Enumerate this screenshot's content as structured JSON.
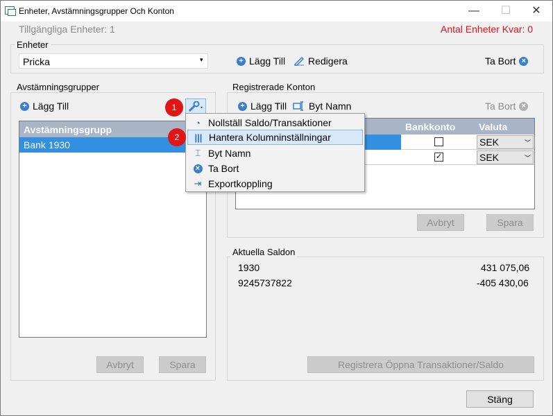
{
  "window": {
    "title": "Enheter, Avstämningsgrupper Och Konton",
    "minimize": "—",
    "maximize": "☐",
    "close": "✕"
  },
  "top": {
    "available_units": "Tillgängliga Enheter: 1",
    "remaining_units": "Antal Enheter Kvar: 0"
  },
  "units": {
    "legend": "Enheter",
    "selected": "Pricka",
    "add": "Lägg Till",
    "edit": "Redigera",
    "remove": "Ta Bort"
  },
  "groups": {
    "legend": "Avstämningsgrupper",
    "add": "Lägg Till",
    "header": "Avstämningsgrupp",
    "items": [
      "Bank 1930"
    ],
    "cancel": "Avbryt",
    "save": "Spara"
  },
  "menu": {
    "items": [
      "Nollställ Saldo/Transaktioner",
      "Hantera Kolumninställningar",
      "Byt Namn",
      "Ta Bort",
      "Exportkoppling"
    ]
  },
  "badges": {
    "one": "1",
    "two": "2"
  },
  "accounts": {
    "legend": "Registrerade Konton",
    "add": "Lägg Till",
    "rename": "Byt Namn",
    "remove": "Ta Bort",
    "col_bank": "Bankkonto",
    "col_currency": "Valuta",
    "rows": [
      {
        "checked": false,
        "currency": "SEK"
      },
      {
        "checked": true,
        "currency": "SEK"
      }
    ],
    "cancel": "Avbryt",
    "save": "Spara"
  },
  "balances": {
    "legend": "Aktuella Saldon",
    "rows": [
      {
        "account": "1930",
        "amount": "431 075,06"
      },
      {
        "account": "9245737822",
        "amount": "-405 430,06"
      }
    ],
    "register_button": "Registrera Öppna Transaktioner/Saldo"
  },
  "footer": {
    "close": "Stäng"
  }
}
